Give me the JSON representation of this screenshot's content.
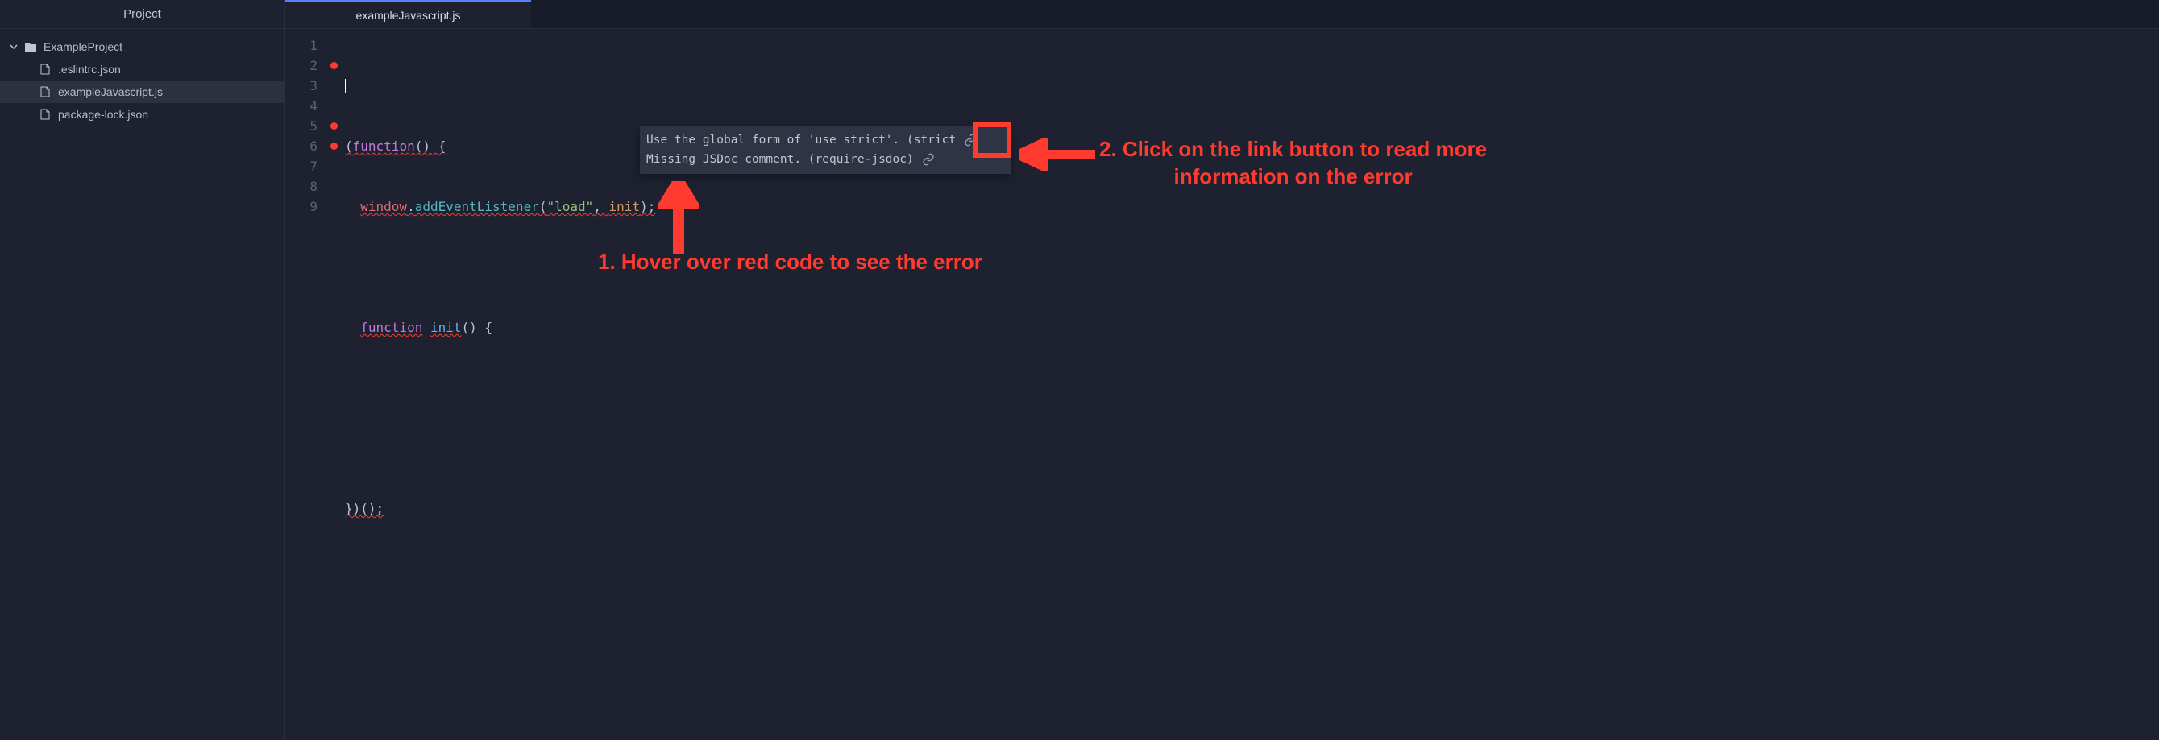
{
  "sidebar": {
    "header": "Project",
    "root": "ExampleProject",
    "files": [
      ".eslintrc.json",
      "exampleJavascript.js",
      "package-lock.json"
    ],
    "selected_index": 1
  },
  "editor": {
    "tab": "exampleJavascript.js",
    "gutter": [
      "1",
      "2",
      "3",
      "4",
      "5",
      "6",
      "7",
      "8",
      "9"
    ],
    "error_dots": [
      false,
      true,
      false,
      false,
      true,
      true,
      false,
      false,
      false
    ],
    "code": {
      "l2": {
        "a": "(",
        "b": "function",
        "c": "() {"
      },
      "l3": {
        "a": "window",
        "b": ".",
        "c": "addEventListener",
        "d": "(",
        "e": "\"load\"",
        "f": ", ",
        "g": "init",
        "h": ");"
      },
      "l5": {
        "a": "function",
        "b": " ",
        "c": "init",
        "d": "() {"
      },
      "l8": {
        "a": "})();"
      }
    }
  },
  "tooltip": {
    "row1_text": "Use the global form of 'use strict'. (strict",
    "row2_text": "Missing JSDoc comment. (require-jsdoc)"
  },
  "annotations": {
    "step1": "1. Hover over red code to see the error",
    "step2a": "2. Click on the link button to read more",
    "step2b": "information on the error"
  }
}
